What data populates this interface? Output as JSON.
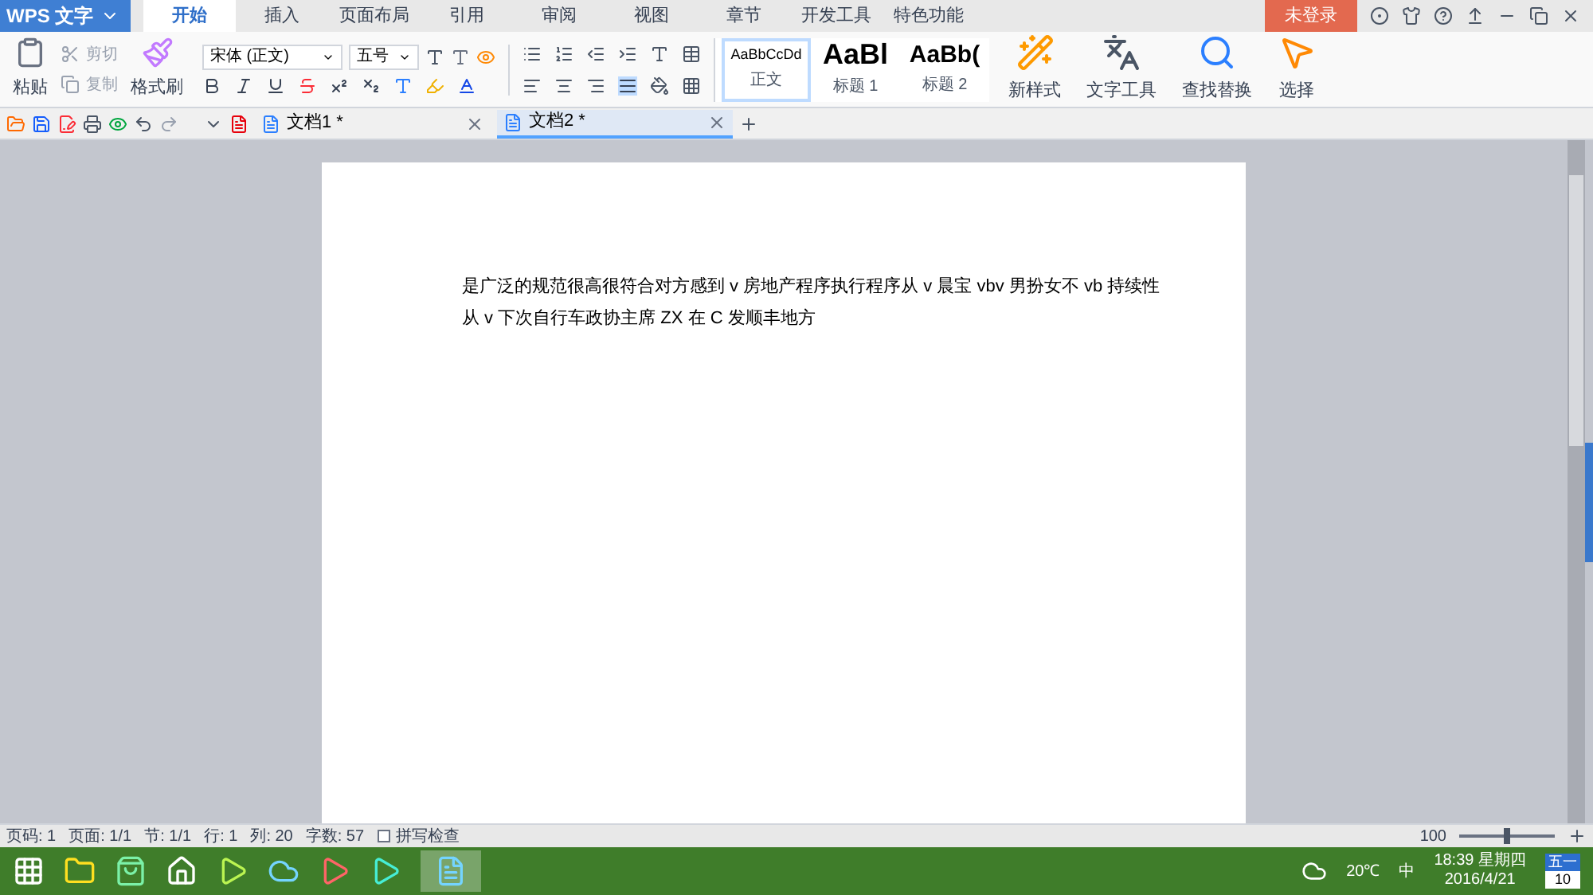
{
  "app_menu": {
    "label": "WPS 文字"
  },
  "tabs": [
    {
      "label": "开始",
      "selected": true
    },
    {
      "label": "插入",
      "selected": false
    },
    {
      "label": "页面布局",
      "selected": false
    },
    {
      "label": "引用",
      "selected": false
    },
    {
      "label": "审阅",
      "selected": false
    },
    {
      "label": "视图",
      "selected": false
    },
    {
      "label": "章节",
      "selected": false
    },
    {
      "label": "开发工具",
      "selected": false
    },
    {
      "label": "特色功能",
      "selected": false
    }
  ],
  "login": {
    "label": "未登录"
  },
  "clipboard": {
    "paste": "粘贴",
    "cut": {
      "label": "剪切",
      "disabled": true
    },
    "copy": {
      "label": "复制",
      "disabled": true
    },
    "format_painter": "格式刷"
  },
  "font": {
    "family": "宋体 (正文)",
    "size": "五号"
  },
  "styles": [
    {
      "preview": "AaBbCcDd",
      "label": "正文",
      "selected": true,
      "kind": "body"
    },
    {
      "preview": "AaBl",
      "label": "标题 1",
      "selected": false,
      "kind": "heading1"
    },
    {
      "preview": "AaBb(",
      "label": "标题 2",
      "selected": false,
      "kind": "heading2"
    }
  ],
  "tools": [
    {
      "label": "新样式",
      "kind": "style"
    },
    {
      "label": "文字工具",
      "kind": "text"
    },
    {
      "label": "查找替换",
      "kind": "find"
    },
    {
      "label": "选择",
      "kind": "select"
    }
  ],
  "doc_tabs": [
    {
      "title": "文档1 *",
      "selected": false
    },
    {
      "title": "文档2 *",
      "selected": true
    }
  ],
  "document": {
    "lines": [
      "是广泛的规范很高很符合对方感到 v 房地产程序执行程序从 v 晨宝 vbv 男扮女不 vb 持续性",
      "从 v 下次自行车政协主席 ZX 在 C 发顺丰地方"
    ]
  },
  "status_bar": {
    "items": [
      "页码: 1",
      "页面: 1/1",
      "节: 1/1",
      "行: 1",
      "列: 20",
      "字数: 57"
    ],
    "spell_check": {
      "label": "拼写检查",
      "checked": false
    },
    "zoom": "100",
    "zoom_slider": {
      "level": 0.5
    }
  },
  "taskbar": {
    "weather": "20℃",
    "ime": "中",
    "time": "18:39 星期四",
    "date": "2016/4/21",
    "calendar_month": "五一",
    "calendar_day": "10"
  }
}
